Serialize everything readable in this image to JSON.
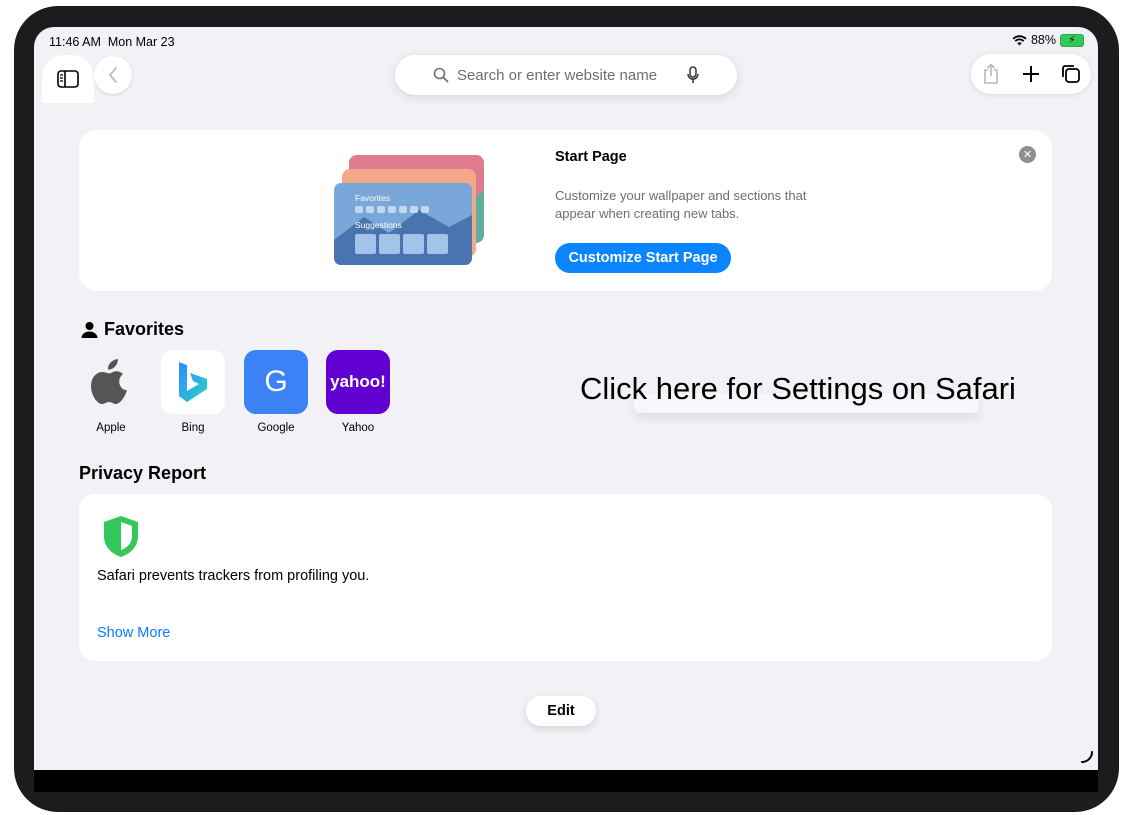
{
  "status": {
    "time": "11:46 AM",
    "date": "Mon Mar 23",
    "battery": "88%"
  },
  "toolbar": {
    "search_placeholder": "Search or enter website name"
  },
  "start_page": {
    "title": "Start Page",
    "description": "Customize your wallpaper and sections that appear when creating new tabs.",
    "button": "Customize Start Page",
    "art_favorites": "Favorites",
    "art_suggestions": "Suggestions"
  },
  "favorites": {
    "heading": "Favorites",
    "items": [
      {
        "label": "Apple",
        "icon": "apple-icon"
      },
      {
        "label": "Bing",
        "icon": "bing-icon"
      },
      {
        "label": "Google",
        "icon": "google-icon",
        "glyph": "G"
      },
      {
        "label": "Yahoo",
        "icon": "yahoo-icon",
        "glyph": "yahoo!"
      }
    ]
  },
  "overlay": {
    "text": "Click here for Settings on Safari"
  },
  "privacy": {
    "heading": "Privacy Report",
    "text": "Safari prevents trackers from profiling you.",
    "link": "Show More"
  },
  "edit_label": "Edit",
  "colors": {
    "accent": "#0a84ff",
    "shield": "#34c759",
    "yahoo": "#6001d2",
    "google": "#3b82f6"
  }
}
